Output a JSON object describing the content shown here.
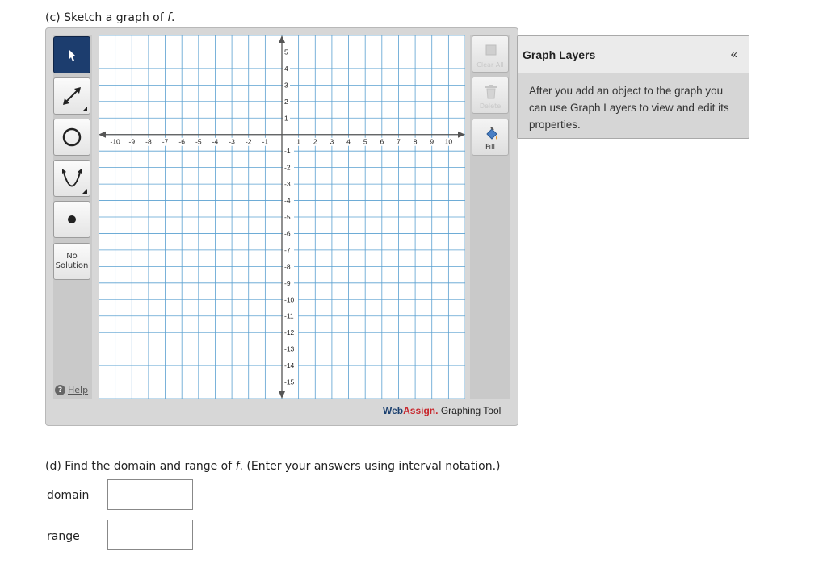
{
  "part_c": {
    "prefix": "(c) Sketch a graph of ",
    "var": "f",
    "suffix": "."
  },
  "toolbar": {
    "tools": [
      {
        "name": "pointer-tool",
        "icon": "arrow-pointer-icon"
      },
      {
        "name": "line-tool",
        "icon": "double-arrow-line-icon"
      },
      {
        "name": "circle-tool",
        "icon": "circle-icon"
      },
      {
        "name": "parabola-tool",
        "icon": "parabola-icon"
      },
      {
        "name": "point-tool",
        "icon": "point-icon"
      }
    ],
    "no_solution_line1": "No",
    "no_solution_line2": "Solution",
    "help": "Help"
  },
  "graph": {
    "x_ticks": [
      "-10",
      "-9",
      "-8",
      "-7",
      "-6",
      "-5",
      "-4",
      "-3",
      "-2",
      "-1",
      "1",
      "2",
      "3",
      "4",
      "5",
      "6",
      "7",
      "8",
      "9",
      "10"
    ],
    "y_ticks": [
      "5",
      "4",
      "3",
      "2",
      "1",
      "-1",
      "-2",
      "-3",
      "-4",
      "-5",
      "-6",
      "-7",
      "-8",
      "-9",
      "-10",
      "-11",
      "-12",
      "-13",
      "-14",
      "-15"
    ]
  },
  "right_toolbar": {
    "clear_all": "Clear All",
    "delete": "Delete",
    "fill": "Fill"
  },
  "brand": {
    "web": "Web",
    "assign": "Assign",
    "dot": ".",
    "rest": " Graphing Tool"
  },
  "layers": {
    "title": "Graph Layers",
    "collapse": "«",
    "body": "After you add an object to the graph you can use Graph Layers to view and edit its properties."
  },
  "part_d": {
    "prefix": "(d) Find the domain and range of ",
    "var": "f",
    "suffix": ". (Enter your answers using interval notation.)"
  },
  "domain_label": "domain",
  "range_label": "range",
  "domain_value": "",
  "range_value": ""
}
